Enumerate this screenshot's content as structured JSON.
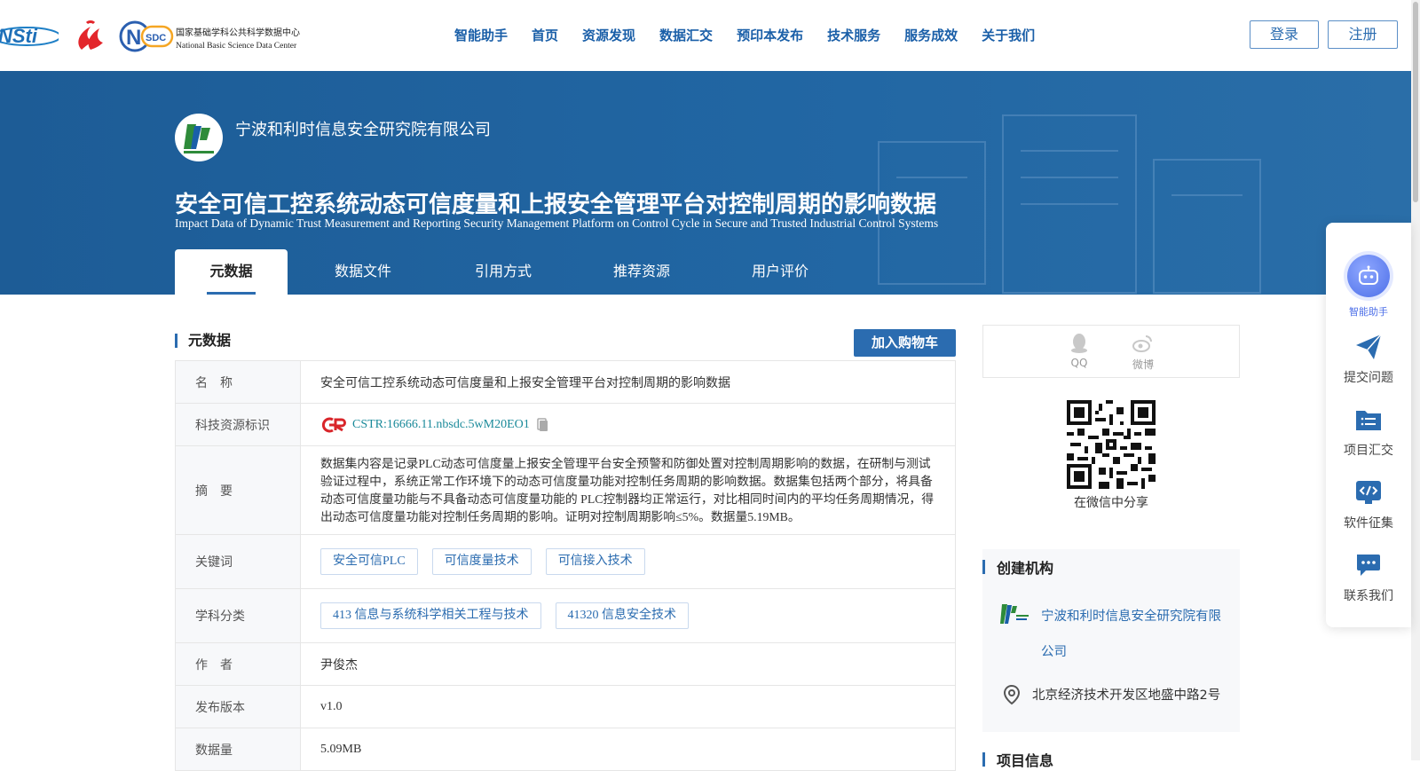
{
  "header": {
    "nav": [
      "智能助手",
      "首页",
      "资源发现",
      "数据汇交",
      "预印本发布",
      "技术服务",
      "服务成效",
      "关于我们"
    ],
    "login_label": "登录",
    "register_label": "注册",
    "logos": {
      "nsti_text": "NSti",
      "nsdc_cn": "国家基础学科公共科学数据中心",
      "nsdc_en": "National Basic Science Data Center",
      "nsdc_badge": "SDC"
    }
  },
  "banner": {
    "org_name": "宁波和利时信息安全研究院有限公司",
    "title_cn": "安全可信工控系统动态可信度量和上报安全管理平台对控制周期的影响数据",
    "title_en": "Impact Data of Dynamic Trust Measurement and Reporting Security Management Platform on Control Cycle in Secure and Trusted Industrial Control Systems",
    "tabs": [
      "元数据",
      "数据文件",
      "引用方式",
      "推荐资源",
      "用户评价"
    ]
  },
  "metadata": {
    "section_title": "元数据",
    "cart_label": "加入购物车",
    "rows": {
      "name": {
        "label": "名　称",
        "value": "安全可信工控系统动态可信度量和上报安全管理平台对控制周期的影响数据"
      },
      "cstr": {
        "label": "科技资源标识",
        "value": "CSTR:16666.11.nbsdc.5wM20EO1"
      },
      "abstract": {
        "label": "摘　要",
        "value": "数据集内容是记录PLC动态可信度量上报安全管理平台安全预警和防御处置对控制周期影响的数据，在研制与测试验证过程中，系统正常工作环境下的动态可信度量功能对控制任务周期的影响数据。数据集包括两个部分，将具备动态可信度量功能与不具备动态可信度量功能的 PLC控制器均正常运行，对比相同时间内的平均任务周期情况，得出动态可信度量功能对控制任务周期的影响。证明对控制周期影响≤5%。数据量5.19MB。"
      },
      "keywords": {
        "label": "关键词",
        "values": [
          "安全可信PLC",
          "可信度量技术",
          "可信接入技术"
        ]
      },
      "subject": {
        "label": "学科分类",
        "values": [
          "413 信息与系统科学相关工程与技术",
          "41320 信息安全技术"
        ]
      },
      "author": {
        "label": "作　者",
        "value": "尹俊杰"
      },
      "version": {
        "label": "发布版本",
        "value": "v1.0"
      },
      "size": {
        "label": "数据量",
        "value": "5.09MB"
      }
    }
  },
  "sidebar": {
    "share": {
      "qq": "QQ",
      "weibo": "微博"
    },
    "qr_caption": "在微信中分享",
    "org_card": {
      "title": "创建机构",
      "org_link": "宁波和利时信息安全研究院有限公司",
      "address": "北京经济技术开发区地盛中路2号"
    },
    "next_section": "项目信息"
  },
  "float_panel": {
    "items": [
      "智能助手",
      "提交问题",
      "项目汇交",
      "软件征集",
      "联系我们"
    ]
  },
  "colors": {
    "brand_blue": "#2b6cb0",
    "banner_blue": "#1d5c96",
    "cstr_teal": "#1a8a9a"
  }
}
